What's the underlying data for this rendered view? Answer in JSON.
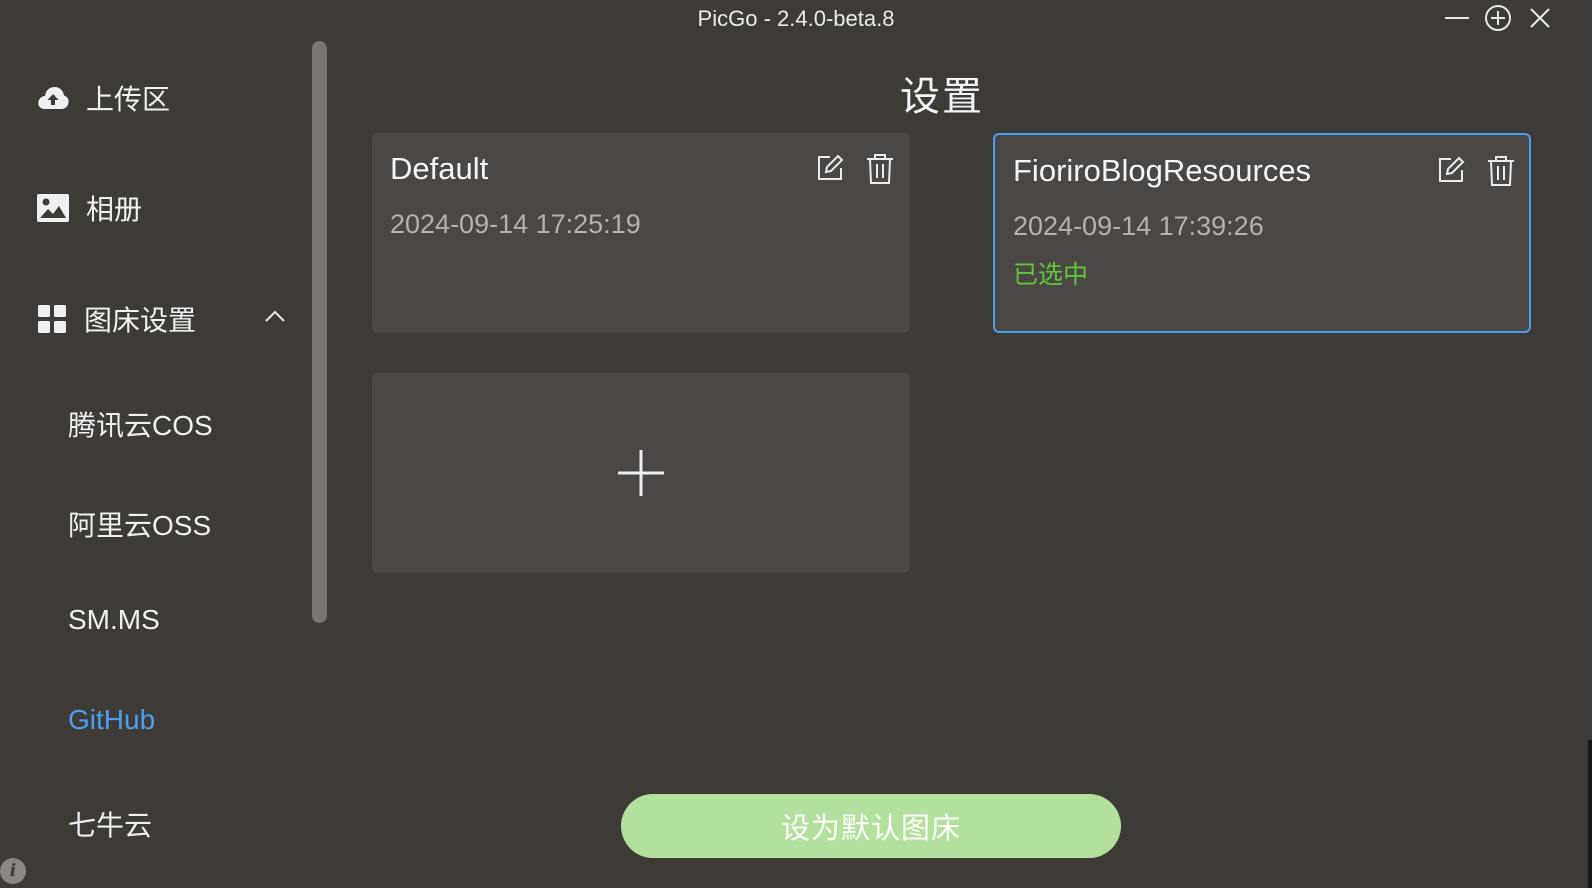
{
  "window": {
    "title": "PicGo - 2.4.0-beta.8"
  },
  "sidebar": {
    "items": [
      {
        "label": "上传区",
        "icon": "cloud-upload-icon"
      },
      {
        "label": "相册",
        "icon": "image-icon"
      },
      {
        "label": "图床设置",
        "icon": "grid-icon",
        "expanded": true
      }
    ],
    "sub_items": [
      {
        "label": "腾讯云COS",
        "active": false
      },
      {
        "label": "阿里云OSS",
        "active": false
      },
      {
        "label": "SM.MS",
        "active": false
      },
      {
        "label": "GitHub",
        "active": true
      },
      {
        "label": "七牛云",
        "active": false
      }
    ]
  },
  "main": {
    "title": "设置",
    "configs": [
      {
        "name": "Default",
        "time": "2024-09-14 17:25:19",
        "status": "",
        "selected": false
      },
      {
        "name": "FioriroBlogResources",
        "time": "2024-09-14 17:39:26",
        "status": "已选中",
        "selected": true
      }
    ],
    "set_default_label": "设为默认图床"
  },
  "colors": {
    "background": "#3e3a36",
    "card": "#4a4744",
    "accent_blue": "#4a9eef",
    "selected_green": "#5fc53a",
    "button_green": "#b3e19d"
  }
}
